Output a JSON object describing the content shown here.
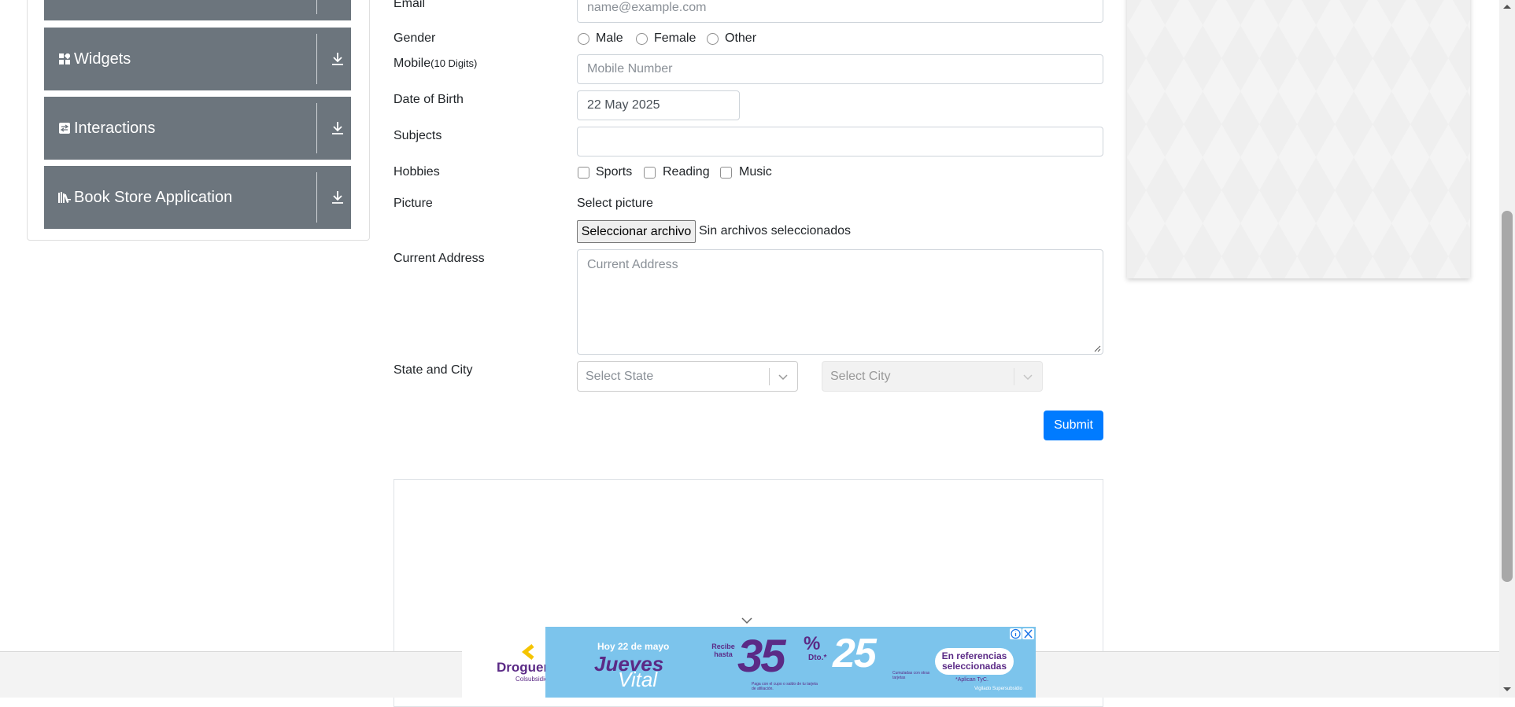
{
  "sidebar": {
    "groups": [
      {
        "label": "Widgets",
        "icon": "widgets-icon"
      },
      {
        "label": "Interactions",
        "icon": "interactions-icon"
      },
      {
        "label": "Book Store Application",
        "icon": "bookstore-icon"
      }
    ]
  },
  "form": {
    "email": {
      "label": "Email",
      "placeholder": "name@example.com"
    },
    "gender": {
      "label": "Gender",
      "options": [
        "Male",
        "Female",
        "Other"
      ]
    },
    "mobile": {
      "label": "Mobile",
      "hint": "(10 Digits)",
      "placeholder": "Mobile Number"
    },
    "dob": {
      "label": "Date of Birth",
      "value": "22 May 2025"
    },
    "subjects": {
      "label": "Subjects",
      "value": ""
    },
    "hobbies": {
      "label": "Hobbies",
      "options": [
        "Sports",
        "Reading",
        "Music"
      ]
    },
    "picture": {
      "label": "Picture",
      "select_label": "Select picture",
      "button": "Seleccionar archivo",
      "status": "Sin archivos seleccionados"
    },
    "address": {
      "label": "Current Address",
      "placeholder": "Current Address"
    },
    "state_city": {
      "label": "State and City",
      "state_placeholder": "Select State",
      "city_placeholder": "Select City"
    },
    "submit": "Submit"
  },
  "ad": {
    "brand": "Droguerías",
    "brand_sub": "Colsubsidio",
    "date": "Hoy 22 de mayo",
    "promo_day": "Jueves",
    "promo_word": "Vital",
    "upto": "Recibe hasta",
    "pct_big": "35",
    "pct_sign": "%",
    "dto": "Dto.*",
    "pct_small": "25",
    "refs": "En referencias seleccionadas",
    "fine1": "Paga con el cupo o saldo de tu tarjeta de afiliación.",
    "fine2": "Cumuladas con otras tarjetas",
    "tyc": "*Aplican TyC.",
    "vigilado": "Vigilado Supersubsidio",
    "colors": {
      "main": "#7cc4ec",
      "purple": "#5b2a86",
      "yellow": "#f5c400"
    }
  },
  "colors": {
    "sidebar_group": "#6c757d",
    "primary": "#007bff"
  }
}
